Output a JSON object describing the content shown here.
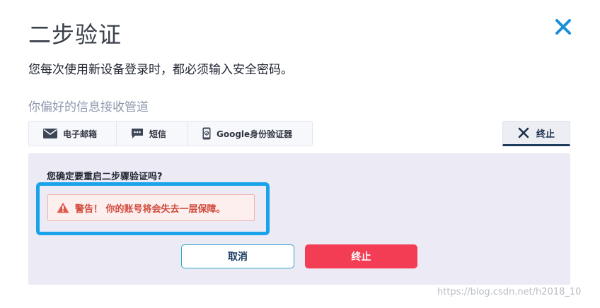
{
  "dialog": {
    "title": "二步验证",
    "description": "您每次使用新设备登录时，都必须输入安全密码。",
    "preferred_channel_label": "你偏好的信息接收管道"
  },
  "channels": [
    {
      "label": "电子邮箱",
      "icon": "envelope-icon"
    },
    {
      "label": "短信",
      "icon": "chat-bubble-icon"
    },
    {
      "label": "Google身份验证器",
      "icon": "authenticator-phone-icon"
    }
  ],
  "stop_tab": {
    "label": "终止",
    "icon": "x-icon"
  },
  "confirm_panel": {
    "question": "您确定要重启二步骤验证吗?",
    "warning": "警告！ 你的账号将会失去一层保障。",
    "cancel_label": "取消",
    "stop_label": "终止"
  },
  "watermark": "https://blog.csdn.net/h2018_10",
  "colors": {
    "close_icon": "#1a8fd6",
    "stop_button": "#f23d54",
    "warning_text": "#d14a3c",
    "warning_bg": "#fcefee",
    "highlight_border": "#19a3e8",
    "panel_bg": "#eceaf5",
    "stop_tab_underline": "#1e3b5c"
  }
}
